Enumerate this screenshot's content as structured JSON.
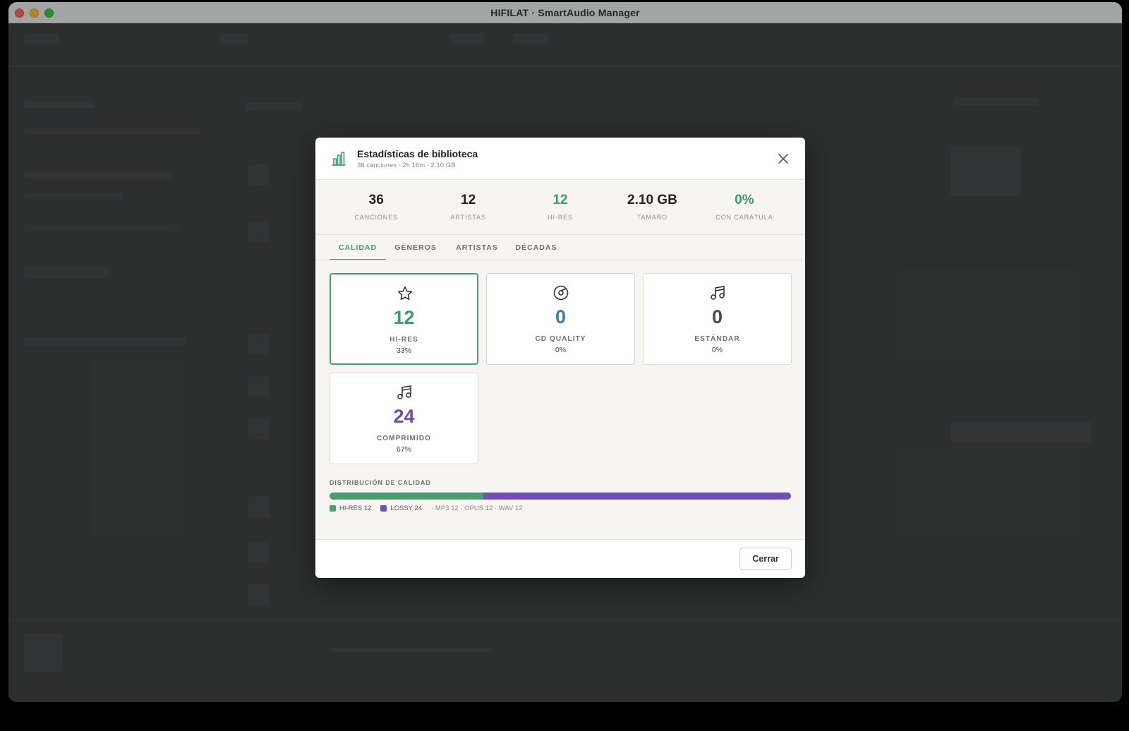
{
  "window": {
    "title": "HIFILAT · SmartAudio Manager"
  },
  "modal": {
    "title": "Estadísticas de biblioteca",
    "subtitle": "36 canciones · 2h 16m · 2.10 GB",
    "summary": [
      {
        "value": "36",
        "label": "CANCIONES",
        "color": "#222222"
      },
      {
        "value": "12",
        "label": "ARTISTAS",
        "color": "#222222"
      },
      {
        "value": "12",
        "label": "HI-RES",
        "color": "#3f9a6c"
      },
      {
        "value": "2.10 GB",
        "label": "TAMAÑO",
        "color": "#222222"
      },
      {
        "value": "0%",
        "label": "CON CARÁTULA",
        "color": "#3f9a6c"
      }
    ],
    "tabs": [
      {
        "label": "CALIDAD",
        "active": true
      },
      {
        "label": "GÉNEROS",
        "active": false
      },
      {
        "label": "ARTISTAS",
        "active": false
      },
      {
        "label": "DÉCADAS",
        "active": false
      }
    ],
    "cards": [
      {
        "icon": "star-icon",
        "value": "12",
        "label": "HI-RES",
        "percent": "33%",
        "color": "#3f9a6c"
      },
      {
        "icon": "disc-icon",
        "value": "0",
        "label": "CD QUALITY",
        "percent": "0%",
        "color": "#3c78b4"
      },
      {
        "icon": "music-note-icon",
        "value": "0",
        "label": "ESTÁNDAR",
        "percent": "0%",
        "color": "#4b4b40"
      },
      {
        "icon": "music-note-icon",
        "value": "24",
        "label": "COMPRIMIDO",
        "percent": "67%",
        "color": "#6c4fb0"
      }
    ],
    "distribution": {
      "title": "DISTRIBUCIÓN DE CALIDAD",
      "segments": [
        {
          "label": "HI-RES 12",
          "fraction": 0.3333,
          "color": "#4a9b72"
        },
        {
          "label": "LOSSY 24",
          "fraction": 0.6667,
          "color": "#6f4fb3"
        }
      ],
      "formats": "· MP3 12 · OPUS 12 · WAV 12"
    },
    "close_button": "Cerrar"
  }
}
